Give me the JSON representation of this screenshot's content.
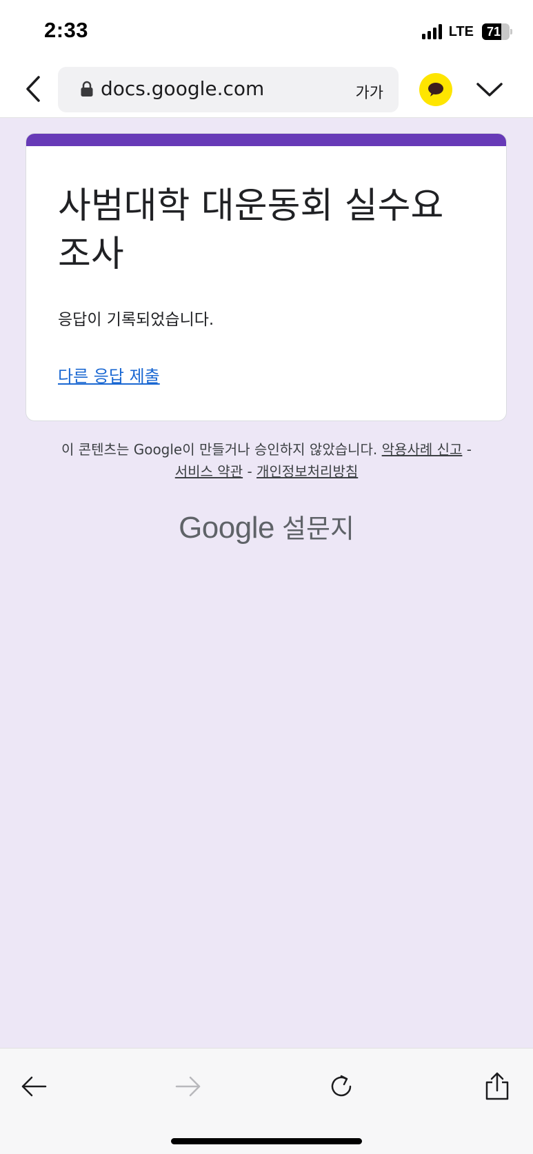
{
  "status_bar": {
    "time": "2:33",
    "network": "LTE",
    "battery_level": 71,
    "battery_text": "71",
    "signal_bars": 4
  },
  "browser": {
    "url": "docs.google.com",
    "text_size_label": "가가",
    "icons": {
      "back": "chevron-left-icon",
      "lock": "lock-icon",
      "kakao": "kakao-talk-icon",
      "menu": "chevron-down-icon"
    }
  },
  "form": {
    "title": "사범대학 대운동회 실수요 조사",
    "confirmation": "응답이 기록되었습니다.",
    "resubmit_link": "다른 응답 제출"
  },
  "footer": {
    "disclaimer": "이 콘텐츠는 Google이 만들거나 승인하지 않았습니다.",
    "link_abuse": "악용사례 신고",
    "separator": "-",
    "link_terms": "서비스 약관",
    "link_privacy": "개인정보처리방침",
    "brand_google": "Google",
    "brand_product": "설문지"
  },
  "toolbar": {
    "icons": [
      "arrow-left-icon",
      "arrow-right-icon",
      "reload-icon",
      "share-icon"
    ],
    "forward_enabled": false
  },
  "colors": {
    "accent": "#673ab7",
    "background": "#ede7f6",
    "link": "#1967d2",
    "kakao_yellow": "#fee500"
  }
}
